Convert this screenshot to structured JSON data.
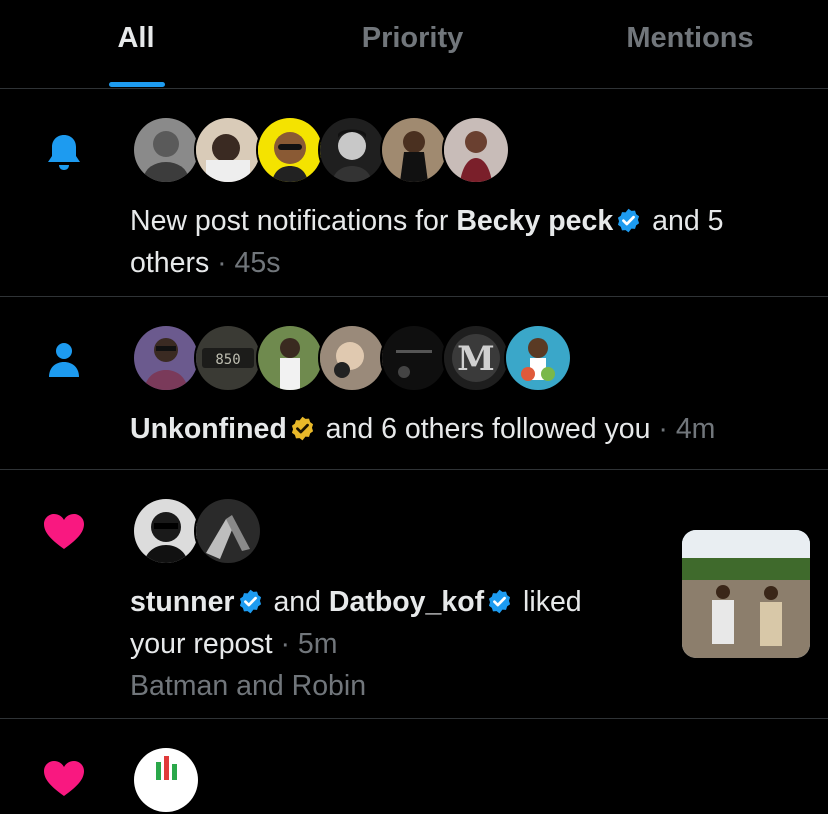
{
  "tabs": [
    {
      "label": "All",
      "active": true
    },
    {
      "label": "Priority",
      "active": false
    },
    {
      "label": "Mentions",
      "active": false
    }
  ],
  "notifications": [
    {
      "type_icon": "bell-icon",
      "avatar_colors": [
        "#8a8a8a",
        "#c9b7a3",
        "#f4e300",
        "#3a3a3a",
        "#6b4f3a",
        "#b8a7a2"
      ],
      "prefix": "New post notifications for",
      "name": "Becky peck",
      "badge": "verified-blue-badge-icon",
      "suffix": "and 5",
      "line2": "others",
      "time": "· 45s"
    },
    {
      "type_icon": "person-icon",
      "avatar_colors": [
        "#6b5a8e",
        "#4a4a40",
        "#7a8a5a",
        "#9a8a7a",
        "#1a1a1a",
        "#2c2c2c",
        "#3aa7c9"
      ],
      "avatar_text": {
        "two": "850",
        "six": "M"
      },
      "name": "Unkonfined",
      "badge": "verified-gold-badge-icon",
      "suffix": "and 6 others followed you",
      "time": "· 4m"
    },
    {
      "type_icon": "heart-icon",
      "avatar_colors": [
        "#dcdcdc",
        "#2a2a2a"
      ],
      "name1": "stunner",
      "badge1": "verified-blue-badge-icon",
      "joiner": "and",
      "name2": "Datboy_kof",
      "badge2": "verified-blue-badge-icon",
      "suffix": "liked",
      "line2": "your repost",
      "time": "· 5m",
      "line3": "Batman and Robin"
    },
    {
      "type_icon": "heart-icon",
      "avatar_colors": [
        "#ffffff"
      ]
    }
  ],
  "colors": {
    "accent_blue": "#1d9bf0",
    "heart_pink": "#f91880",
    "verified_gold": "#e8b829",
    "muted_text": "#71767b",
    "divider": "#2f3336"
  }
}
